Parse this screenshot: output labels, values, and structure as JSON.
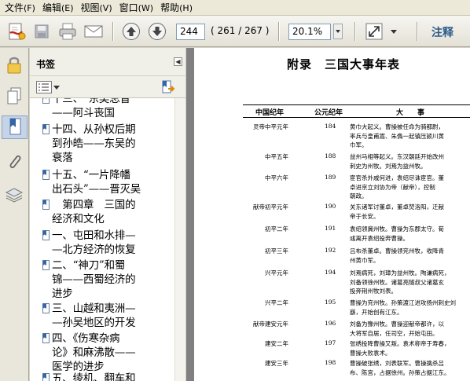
{
  "menubar": [
    {
      "label": "文件",
      "acc": "(F)"
    },
    {
      "label": "编辑",
      "acc": "(E)"
    },
    {
      "label": "视图",
      "acc": "(V)"
    },
    {
      "label": "窗口",
      "acc": "(W)"
    },
    {
      "label": "帮助",
      "acc": "(H)"
    }
  ],
  "toolbar": {
    "page_input": "244",
    "page_count": "( 261 / 267 )",
    "zoom_input": "20.1%",
    "comment_label": "注释"
  },
  "bookmarks": {
    "title": "书签",
    "items": [
      {
        "label": "十三、“东吴总督”\n——阿斗丧国"
      },
      {
        "label": "十四、从孙权后期\n到孙皓——东吴的\n衰落"
      },
      {
        "label": "十五、“一片降幡\n出石头”——晋灭吴"
      },
      {
        "label": "　第四章　三国的\n经济和文化"
      },
      {
        "label": "一、屯田和水排—\n—北方经济的恢复"
      },
      {
        "label": "二、“神刀”和蜀\n锦——西蜀经济的\n进步"
      },
      {
        "label": "三、山越和夷洲—\n—孙吴地区的开发"
      },
      {
        "label": "四、《伤寒杂病\n论》和麻沸散——\n医学的进步"
      },
      {
        "label": "五、绫机、翻车和\n指南车"
      }
    ]
  },
  "document": {
    "title": "附录　三国大事年表",
    "headers": {
      "era": "中国纪年",
      "year": "公元纪年",
      "event": "大　　事"
    },
    "rows": [
      {
        "era": "灵帝中平元年",
        "year": "184",
        "event": "黄巾大起义。曹操被任命为骑都尉，\n率兵与皇甫嵩、朱儁一起镇压颍川黄\n巾军。"
      },
      {
        "era": "中平五年",
        "year": "188",
        "event": "益州马相等起义。东汉朝廷开始改州\n刺史为州牧。刘焉为益州牧。"
      },
      {
        "era": "中平六年",
        "year": "189",
        "event": "宦官杀外戚何进，袁绍尽诛宦官。董\n卓进京立刘协为帝（献帝），控制\n朝政。"
      },
      {
        "era": "献帝初平元年",
        "year": "190",
        "event": "关东诸军讨董卓，董卓焚洛阳，迁献\n帝于长安。"
      },
      {
        "era": "初平二年",
        "year": "191",
        "event": "袁绍领冀州牧。曹操为东郡太守。荀\n彧离开袁绍投奔曹操。"
      },
      {
        "era": "初平三年",
        "year": "192",
        "event": "吕布杀董卓。曹操领兖州牧，收降青\n州黄巾军。"
      },
      {
        "era": "兴平元年",
        "year": "194",
        "event": "刘焉病死，刘璋为益州牧。陶谦病死，\n刘备领徐州牧。诸葛亮随叔父诸葛玄\n投奔荆州牧刘表。"
      },
      {
        "era": "兴平二年",
        "year": "195",
        "event": "曹操为兖州牧。孙策渡江进攻扬州刺史刘\n繇，开始创有江东。"
      },
      {
        "era": "献帝建安元年",
        "year": "196",
        "event": "刘备为豫州牧。曹操迎献帝都许，以\n大将军自居，任司空，开始屯田。"
      },
      {
        "era": "建安二年",
        "year": "197",
        "event": "张绣投降曹操又叛。袁术称帝于寿春，\n曹操大败袁术。"
      },
      {
        "era": "建安三年",
        "year": "198",
        "event": "曹操破张绣，刘表联军。曹操擒杀吕\n布、陈宫，占据徐州。孙策占据江东。"
      }
    ]
  }
}
